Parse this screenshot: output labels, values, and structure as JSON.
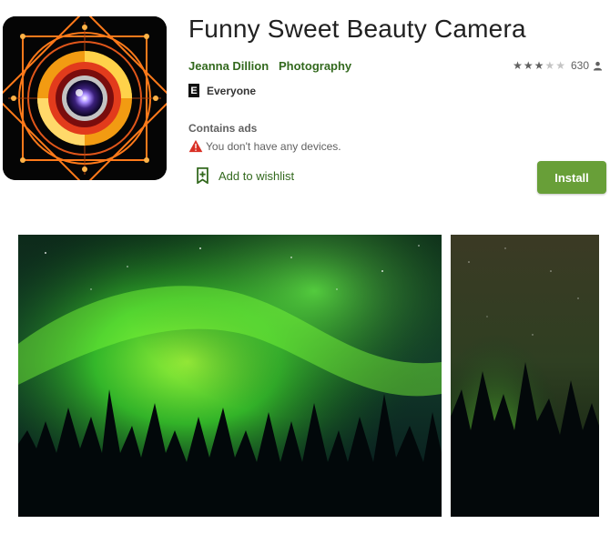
{
  "app": {
    "title": "Funny Sweet Beauty Camera",
    "developer": "Jeanna Dillion",
    "category": "Photography",
    "rating_stars": 3,
    "rating_max": 5,
    "rating_count": "630",
    "content_rating_badge": "E",
    "content_rating": "Everyone",
    "contains_ads": "Contains ads",
    "device_warning": "You don't have any devices.",
    "wishlist_label": "Add to wishlist",
    "install_label": "Install"
  },
  "icons": {
    "app_icon": "camera-lens-mandala-icon",
    "rating": "star-icon",
    "person": "person-icon",
    "warning": "warning-icon",
    "wishlist": "bookmark-add-icon"
  },
  "colors": {
    "accent_green": "#33691e",
    "install_bg": "#689f38",
    "warning_red": "#d93025",
    "text_gray": "#616161"
  },
  "screenshots": [
    {
      "subject": "aurora-borealis-over-pine-forest"
    },
    {
      "subject": "aurora-borealis-over-pine-forest"
    }
  ]
}
